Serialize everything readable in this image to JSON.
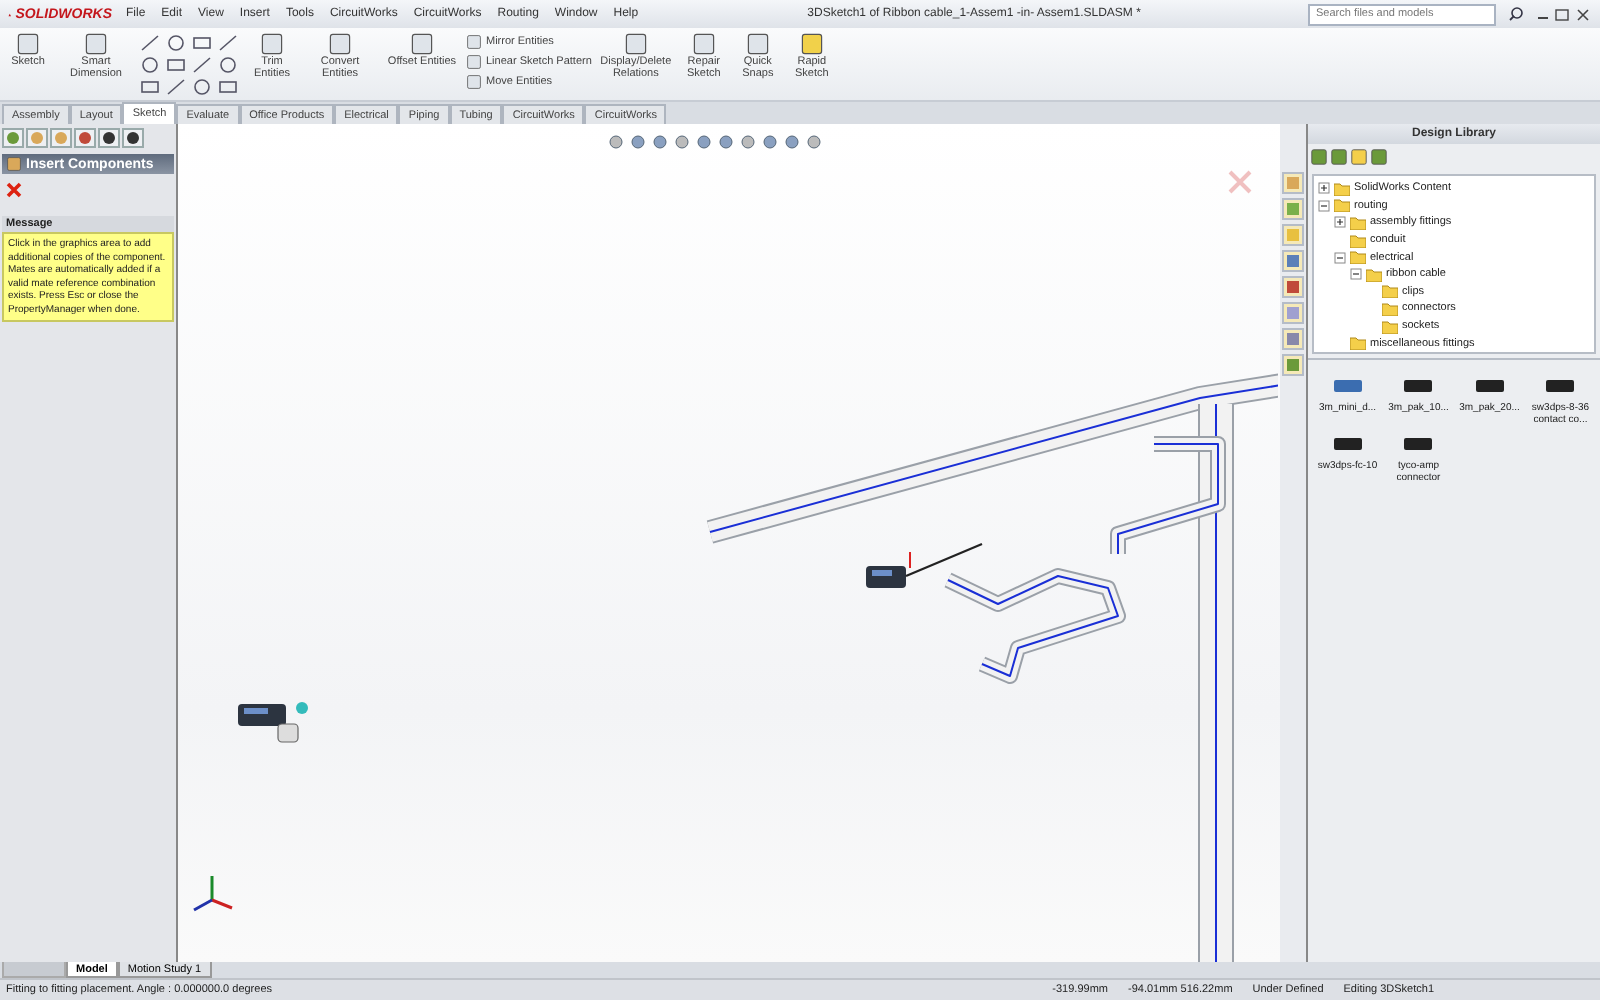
{
  "app": {
    "logo": "SOLIDWORKS"
  },
  "menu": [
    "File",
    "Edit",
    "View",
    "Insert",
    "Tools",
    "CircuitWorks",
    "CircuitWorks",
    "Routing",
    "Window",
    "Help"
  ],
  "window": {
    "title": "3DSketch1 of Ribbon cable_1-Assem1 -in- Assem1.SLDASM *"
  },
  "search": {
    "placeholder": "Search files and models"
  },
  "ribbon": [
    {
      "kind": "large",
      "label": "Sketch"
    },
    {
      "kind": "large",
      "label": "Smart Dimension"
    },
    {
      "kind": "tools"
    },
    {
      "kind": "large",
      "label": "Trim Entities"
    },
    {
      "kind": "large",
      "label": "Convert Entities"
    },
    {
      "kind": "large",
      "label": "Offset Entities"
    },
    {
      "kind": "stack",
      "labels": [
        "Mirror Entities",
        "Linear Sketch Pattern",
        "Move Entities"
      ]
    },
    {
      "kind": "large",
      "label": "Display/Delete Relations"
    },
    {
      "kind": "large",
      "label": "Repair Sketch"
    },
    {
      "kind": "large",
      "label": "Quick Snaps"
    },
    {
      "kind": "large",
      "label": "Rapid Sketch"
    }
  ],
  "tabs": [
    {
      "label": "Assembly",
      "selected": false
    },
    {
      "label": "Layout",
      "selected": false
    },
    {
      "label": "Sketch",
      "selected": true
    },
    {
      "label": "Evaluate",
      "selected": false
    },
    {
      "label": "Office Products",
      "selected": false
    },
    {
      "label": "Electrical",
      "selected": false
    },
    {
      "label": "Piping",
      "selected": false
    },
    {
      "label": "Tubing",
      "selected": false
    },
    {
      "label": "CircuitWorks",
      "selected": false
    },
    {
      "label": "CircuitWorks",
      "selected": false
    }
  ],
  "property_manager": {
    "title": "Insert Components",
    "message_title": "Message",
    "message": "Click in the graphics area to add additional copies of the component. Mates are automatically added if a valid mate reference combination exists. Press Esc or close the PropertyManager when done."
  },
  "design_library": {
    "title": "Design Library",
    "tree": [
      {
        "label": "SolidWorks Content",
        "expanded": false
      },
      {
        "label": "routing",
        "expanded": true,
        "children": [
          {
            "label": "assembly fittings",
            "expanded": false
          },
          {
            "label": "conduit"
          },
          {
            "label": "electrical",
            "expanded": true,
            "children": [
              {
                "label": "ribbon cable",
                "expanded": true,
                "children": [
                  {
                    "label": "clips"
                  },
                  {
                    "label": "connectors"
                  },
                  {
                    "label": "sockets"
                  }
                ]
              }
            ]
          },
          {
            "label": "miscellaneous fittings"
          }
        ]
      }
    ],
    "items": [
      {
        "label": "3m_mini_d..."
      },
      {
        "label": "3m_pak_10..."
      },
      {
        "label": "3m_pak_20..."
      },
      {
        "label": "sw3dps-8-36 contact co..."
      },
      {
        "label": "sw3dps-fc-10"
      },
      {
        "label": "tyco-amp connector"
      }
    ]
  },
  "bottom_tabs": [
    {
      "label": "Model",
      "selected": true
    },
    {
      "label": "Motion Study 1",
      "selected": false
    }
  ],
  "status_bar": {
    "message": "Fitting to fitting placement.  Angle : 0.000000.0 degrees",
    "fields": [
      "-319.99mm",
      "-94.01mm 516.22mm",
      "Under Defined",
      "Editing 3DSketch1"
    ]
  }
}
